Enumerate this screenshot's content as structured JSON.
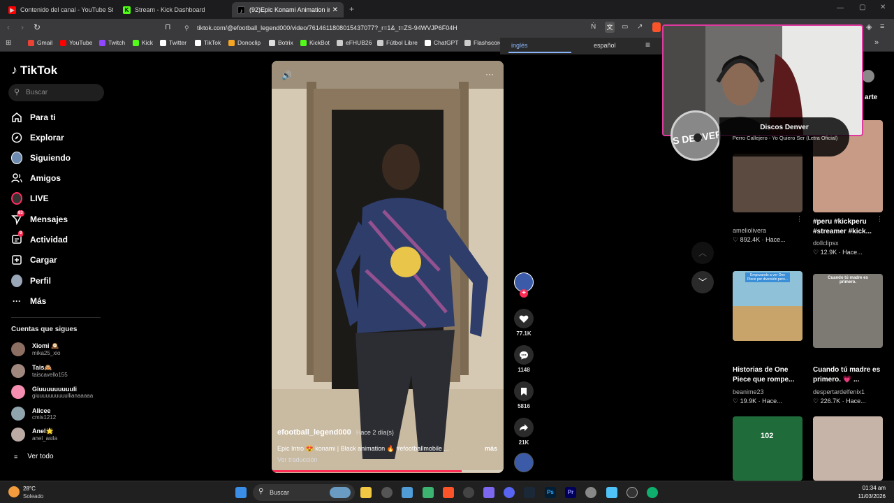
{
  "tabs": [
    {
      "label": "Contenido del canal - YouTube Studio",
      "icon": "youtube-icon",
      "color": "#ff0000"
    },
    {
      "label": "Stream - Kick Dashboard",
      "icon": "kick-icon",
      "color": "#53fc18"
    },
    {
      "label": "(92)Epic Konami Animation in",
      "icon": "tiktok-icon",
      "color": "#ffffff"
    }
  ],
  "address": {
    "url": "tiktok.com/@efootball_legend000/video/7614611808015437077?_r=1&_t=ZS-94WVJP6F04H"
  },
  "bookmarks": [
    {
      "label": "Gmail",
      "color": "#ea4335"
    },
    {
      "label": "YouTube",
      "color": "#ff0000"
    },
    {
      "label": "Twitch",
      "color": "#9146ff"
    },
    {
      "label": "Kick",
      "color": "#53fc18"
    },
    {
      "label": "Twitter",
      "color": "#ffffff"
    },
    {
      "label": "TikTok",
      "color": "#ffffff"
    },
    {
      "label": "Donoclip",
      "color": "#f5a623"
    },
    {
      "label": "Botrix",
      "color": "#dddddd"
    },
    {
      "label": "KickBot",
      "color": "#53fc18"
    },
    {
      "label": "eFHUB26",
      "color": "#cccccc"
    },
    {
      "label": "Fútbol Libre",
      "color": "#cccccc"
    },
    {
      "label": "ChatGPT",
      "color": "#ffffff"
    },
    {
      "label": "Flashscore",
      "color": "#cccccc"
    }
  ],
  "translate": {
    "tab1": "inglés",
    "tab2": "español"
  },
  "sidebar": {
    "logo": "TikTok",
    "search_placeholder": "Buscar",
    "nav": [
      {
        "label": "Para ti",
        "icon": "home-icon"
      },
      {
        "label": "Explorar",
        "icon": "compass-icon"
      },
      {
        "label": "Siguiendo",
        "icon": "avatar-icon"
      },
      {
        "label": "Amigos",
        "icon": "friends-icon"
      },
      {
        "label": "LIVE",
        "icon": "live-icon"
      },
      {
        "label": "Mensajes",
        "icon": "send-icon",
        "badge": "83"
      },
      {
        "label": "Actividad",
        "icon": "inbox-icon",
        "badge": "9"
      },
      {
        "label": "Cargar",
        "icon": "plus-square-icon"
      },
      {
        "label": "Perfil",
        "icon": "avatar-icon"
      },
      {
        "label": "Más",
        "icon": "more-icon"
      }
    ],
    "following_title": "Cuentas que sigues",
    "following": [
      {
        "name": "Xiomi 🕰️",
        "handle": "mika25_xio",
        "color": "#8d6e63"
      },
      {
        "name": "Tais🙈",
        "handle": "taiscavello155",
        "color": "#a1887f"
      },
      {
        "name": "Giuuuuuuuuuli",
        "handle": "giuuuuuuuuuullianaaaaa",
        "color": "#f48fb1"
      },
      {
        "name": "Alicee",
        "handle": "cmis1212",
        "color": "#90a4ae"
      },
      {
        "name": "Anel🌟",
        "handle": "anel_asila",
        "color": "#bcaaa4"
      }
    ],
    "see_all": "Ver todo"
  },
  "video": {
    "author": "efootball_legend000",
    "age": "Hace 2 día(s)",
    "caption": "Epic Intro 😍 konami | Black animation 🔥 #efootballmobile ...",
    "more": "más",
    "translate": "Ver traducción",
    "progress": 0.82
  },
  "actions": [
    {
      "icon": "heart-icon",
      "count": "77.1K"
    },
    {
      "icon": "comment-icon",
      "count": "1148"
    },
    {
      "icon": "bookmark-icon",
      "count": "5816"
    },
    {
      "icon": "share-icon",
      "count": "21K"
    }
  ],
  "overlay": {
    "title": "Discos Denver",
    "song": "Perro Callejero - Yo Quiero Ser (Letra Oficial)",
    "disc_text": "IS DENVER",
    "partial": "arte"
  },
  "grid": [
    {
      "title": "",
      "user": "ameliolivera",
      "likes": "892.4K",
      "time": "Hace..."
    },
    {
      "title": "#peru #kickperu #streamer #kick...",
      "user": "dollclipsx",
      "likes": "12.9K",
      "time": "Hace..."
    },
    {
      "title": "Historias de One Piece que rompe...",
      "user": "beanime23",
      "likes": "19.9K",
      "time": "Hace...",
      "thumb_text": "Empezando a ver One Piece por diversión pero..."
    },
    {
      "title": "Cuando tú madre es primero. 💗 ...",
      "user": "despertardelfenix1",
      "likes": "226.7K",
      "time": "Hace...",
      "thumb_text": "Cuando tú madre es primero."
    },
    {
      "title": "",
      "user": "",
      "likes": "",
      "time": "",
      "thumb_text": "102"
    },
    {
      "title": "",
      "user": "",
      "likes": "",
      "time": ""
    }
  ],
  "taskbar": {
    "weather_temp": "28°C",
    "weather_desc": "Soleado",
    "search": "Buscar",
    "time": "01:34 am",
    "date": "11/03/2026"
  }
}
